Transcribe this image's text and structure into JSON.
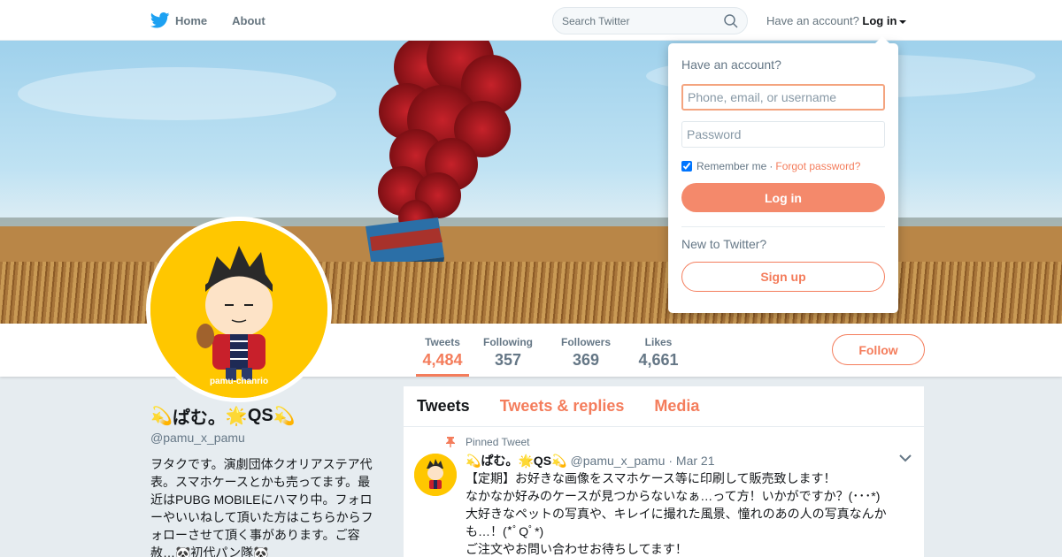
{
  "nav": {
    "home_label": "Home",
    "about_label": "About",
    "search_placeholder": "Search Twitter",
    "have_account_text": "Have an account?",
    "login_label": "Log in"
  },
  "profile": {
    "display_name": "ぱむ。",
    "display_suffix": "QS",
    "handle": "@pamu_x_pamu",
    "bio": "ヲタクです。演劇団体クオリアステア代表。スマホケースとかも売ってます。最近はPUBG MOBILEにハマり中。フォローやいいねして頂いた方はこちらからフォローさせて頂く事があります。ご容赦…🐼初代パン隊🐼",
    "avatar_caption": "pamu-chanrio"
  },
  "stats": [
    {
      "label": "Tweets",
      "value": "4,484"
    },
    {
      "label": "Following",
      "value": "357"
    },
    {
      "label": "Followers",
      "value": "369"
    },
    {
      "label": "Likes",
      "value": "4,661"
    }
  ],
  "follow_label": "Follow",
  "tabs": [
    {
      "label": "Tweets"
    },
    {
      "label": "Tweets & replies"
    },
    {
      "label": "Media"
    }
  ],
  "pinned_tweet": {
    "pinned_label": "Pinned Tweet",
    "name": "ぱむ。",
    "name_suffix": "QS",
    "handle": "@pamu_x_pamu",
    "date": "· Mar 21",
    "lines": [
      "【定期】お好きな画像をスマホケース等に印刷して販売致します！",
      "なかなか好みのケースが見つからないなぁ…って方！いかがですか？(･･･*)",
      "大好きなペットの写真や、キレイに撮れた風景、憧れのあの人の写真なんかも…！(*ﾟQﾟ*)",
      "ご注文やお問い合わせお待ちしてます！"
    ]
  },
  "login_dropdown": {
    "title": "Have an account?",
    "username_placeholder": "Phone, email, or username",
    "password_placeholder": "Password",
    "remember_label": "Remember me",
    "separator": "·",
    "forgot_label": "Forgot password?",
    "login_button": "Log in",
    "new_to_text": "New to Twitter?",
    "signup_button": "Sign up"
  },
  "colors": {
    "accent": "#f47d5c",
    "twitter_blue": "#1da1f2",
    "avatar_bg": "#ffc700"
  }
}
